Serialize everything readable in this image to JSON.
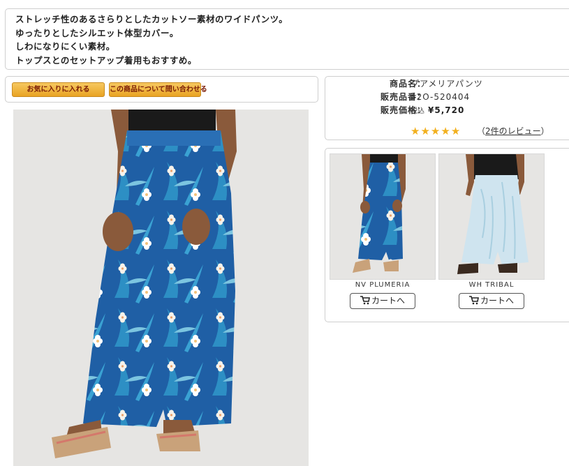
{
  "description": {
    "lines": [
      "ストレッチ性のあるさらりとしたカットソー素材のワイドパンツ。",
      "ゆったりとしたシルエット体型カバー。",
      "しわになりにくい素材。",
      "トップスとのセットアップ着用もおすすめ。"
    ]
  },
  "actions": {
    "favorite_label": "お気に入りに入れる",
    "inquiry_label": "この商品について問い合わせる"
  },
  "product": {
    "name_label": "商品名：",
    "name": "プアメリアパンツ",
    "code_label": "販売品番：",
    "code": "42O-520404",
    "price_label": "販売価格：",
    "tax_label": "税込",
    "price": "¥5,720",
    "rating": 5,
    "review_open": "（",
    "review_link": "2件のレビュー",
    "review_close": "）"
  },
  "variants": [
    {
      "name": "NV PLUMERIA",
      "cart_label": "カートへ"
    },
    {
      "name": "WH TRIBAL",
      "cart_label": "カートへ"
    }
  ],
  "colors": {
    "button_gold": "#f0b840",
    "button_text": "#7a1b06",
    "star": "#f2b01e",
    "navy_print": "#1f5fa5",
    "light_print": "#cfe4ef"
  },
  "icons": [
    "star-icon",
    "cart-icon"
  ]
}
